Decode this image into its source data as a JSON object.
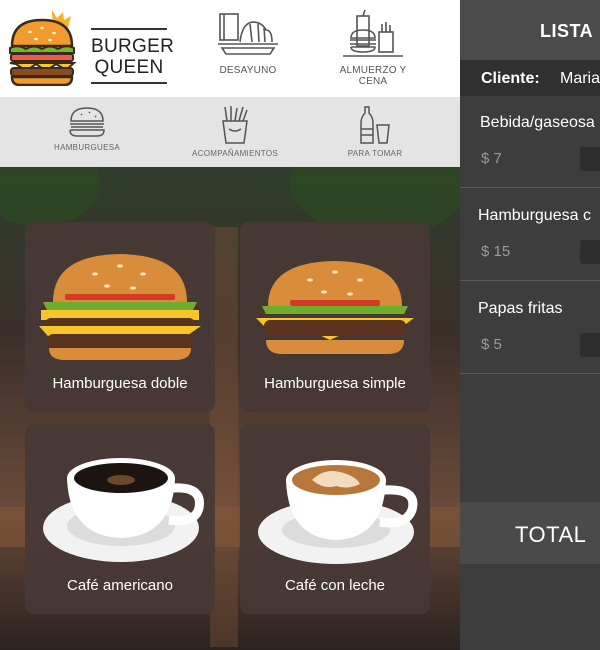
{
  "brand": {
    "line1": "BURGER",
    "line2": "QUEEN"
  },
  "main_categories": [
    {
      "label": "DESAYUNO",
      "icon": "breakfast-icon"
    },
    {
      "label_line1": "ALMUERZO Y",
      "label_line2": "CENA",
      "icon": "lunch-dinner-icon"
    }
  ],
  "sub_categories": [
    {
      "label": "HAMBURGUESA",
      "icon": "burger-icon"
    },
    {
      "label": "ACOMPAÑAMIENTOS",
      "icon": "fries-icon"
    },
    {
      "label": "PARA TOMAR",
      "icon": "drinks-icon"
    }
  ],
  "products": [
    {
      "name": "Hamburguesa doble"
    },
    {
      "name": "Hamburguesa simple"
    },
    {
      "name": "Café americano"
    },
    {
      "name": "Café con leche"
    }
  ],
  "order": {
    "title": "LISTA",
    "client_label": "Cliente:",
    "client_name": "Maria",
    "items": [
      {
        "name": "Bebida/gaseosa",
        "price": "$ 7"
      },
      {
        "name": "Hamburguesa c",
        "price": "$ 15"
      },
      {
        "name": "Papas fritas",
        "price": "$ 5"
      }
    ],
    "total_label": "TOTAL"
  },
  "colors": {
    "card": "#463836",
    "panel": "#3d3d3d",
    "panel_header": "#4b4b4b",
    "client_bar": "#303030",
    "subnav": "#e4e4e4"
  }
}
